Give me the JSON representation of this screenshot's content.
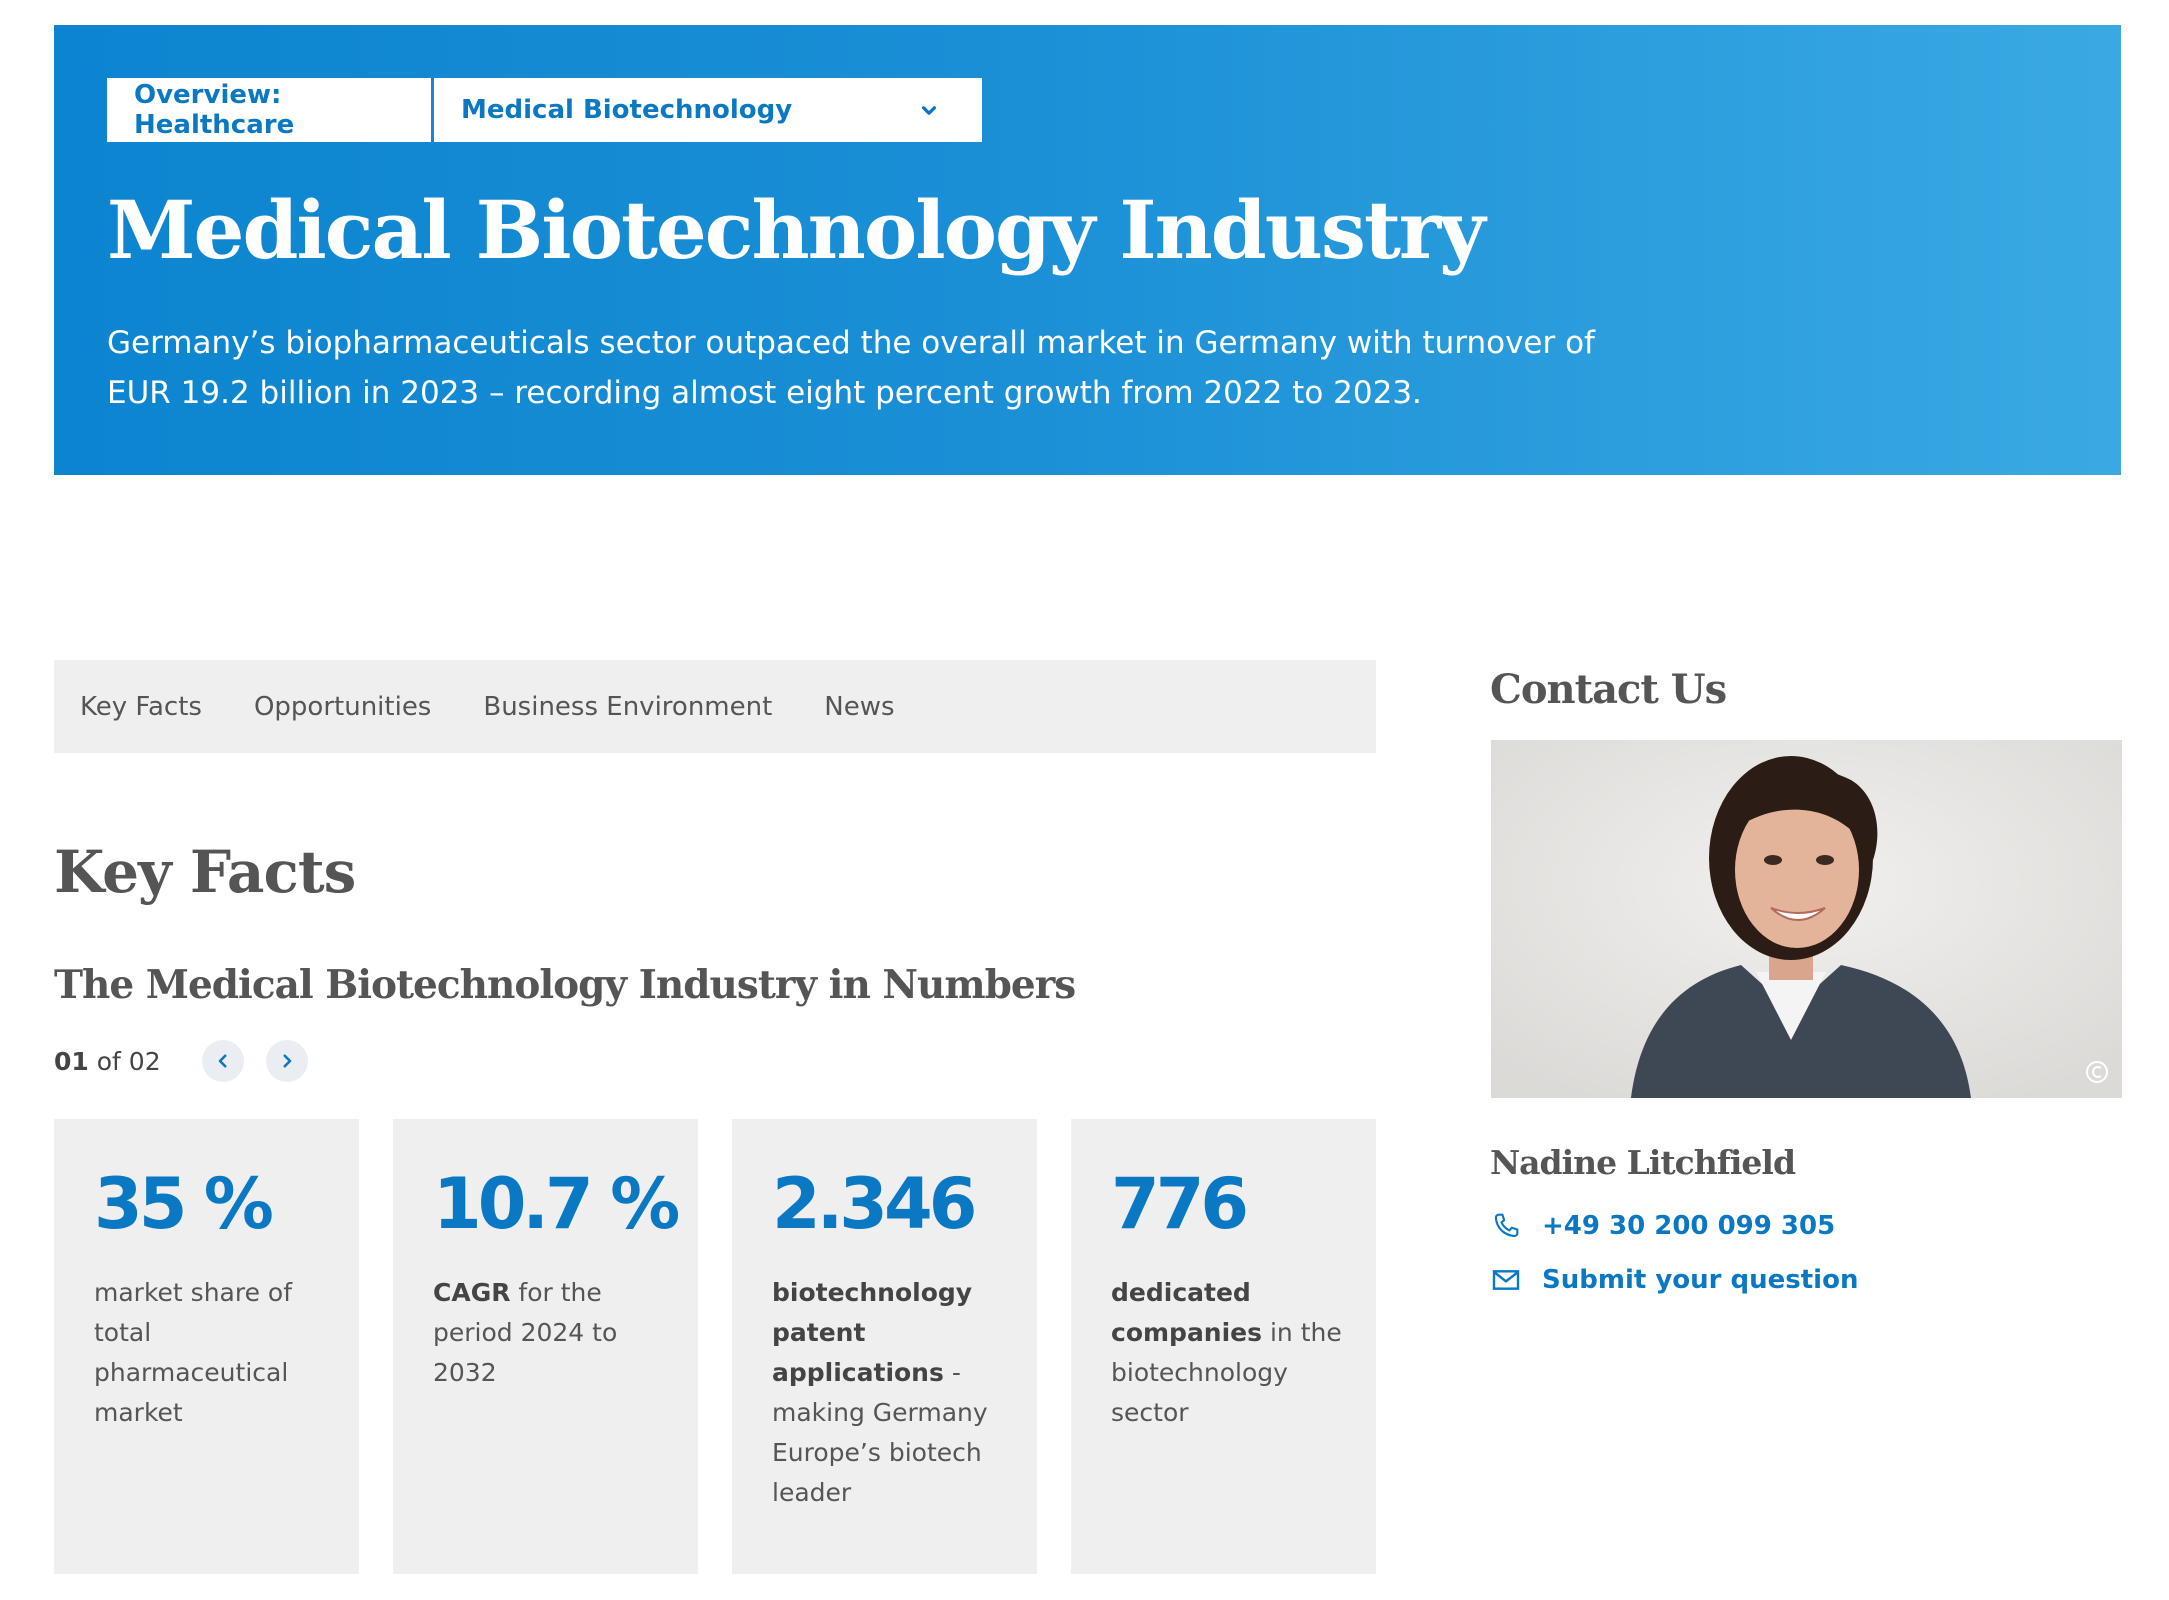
{
  "hero": {
    "breadcrumb_overview": "Overview: Healthcare",
    "breadcrumb_current": "Medical Biotechnology",
    "title": "Medical Biotechnology Industry",
    "description": "Germany’s biopharmaceuticals sector outpaced the overall market in Germany with turnover of EUR 19.2 billion in 2023 – recording almost eight percent growth from 2022 to 2023."
  },
  "tabs": [
    {
      "label": "Key Facts"
    },
    {
      "label": "Opportunities"
    },
    {
      "label": "Business Environment"
    },
    {
      "label": "News"
    }
  ],
  "key_facts": {
    "heading": "Key Facts",
    "subheading": "The Medical Biotechnology Industry in Numbers",
    "pager": {
      "current": "01",
      "of_text": " of 02"
    },
    "cards": [
      {
        "value": "35 %",
        "bold": "",
        "text": "market share of total pharmaceutical market"
      },
      {
        "value": "10.7 %",
        "bold": "CAGR",
        "text": " for the period 2024 to 2032"
      },
      {
        "value": "2.346",
        "bold": "biotechnology patent applications",
        "text": " - making Germany Europe’s biotech leader"
      },
      {
        "value": "776",
        "bold": "dedicated companies",
        "text": " in the biotechnology sector"
      }
    ]
  },
  "contact": {
    "heading": "Contact Us",
    "name": "Nadine Litchfield",
    "phone": "+49 30 200 099 305",
    "submit_label": "Submit your question"
  },
  "colors": {
    "brand_blue": "#0a78c2",
    "hero_gradient_start": "#0c84cf",
    "hero_gradient_end": "#3aa9e3",
    "card_bg": "#efefef"
  },
  "icons": [
    "chevron-down-icon",
    "chevron-left-icon",
    "chevron-right-icon",
    "phone-icon",
    "mail-icon",
    "copyright-icon"
  ]
}
